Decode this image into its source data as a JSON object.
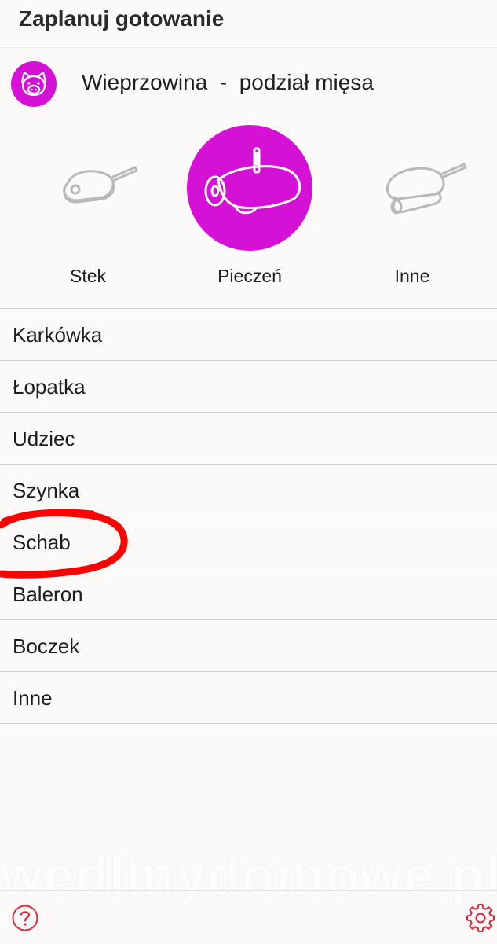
{
  "page": {
    "title": "Zaplanuj gotowanie"
  },
  "category": {
    "icon": "pig-icon",
    "label": "Wieprzowina  -  podział mięsa"
  },
  "methods": [
    {
      "label": "Stek",
      "icon": "steak-pan-icon",
      "selected": false
    },
    {
      "label": "Pieczeń",
      "icon": "roast-thermometer-icon",
      "selected": true
    },
    {
      "label": "Inne",
      "icon": "meat-pan-icon",
      "selected": false
    }
  ],
  "cuts": [
    "Karkówka",
    "Łopatka",
    "Udziec",
    "Szynka",
    "Schab",
    "Baleron",
    "Boczek",
    "Inne"
  ],
  "watermark": "wedlinydomowe.pl",
  "footer": {
    "help_icon": "help-icon",
    "settings_icon": "gear-icon"
  },
  "colors": {
    "accent": "#d511d5",
    "annotation": "#ff0000",
    "divider": "#cfcfcf"
  }
}
